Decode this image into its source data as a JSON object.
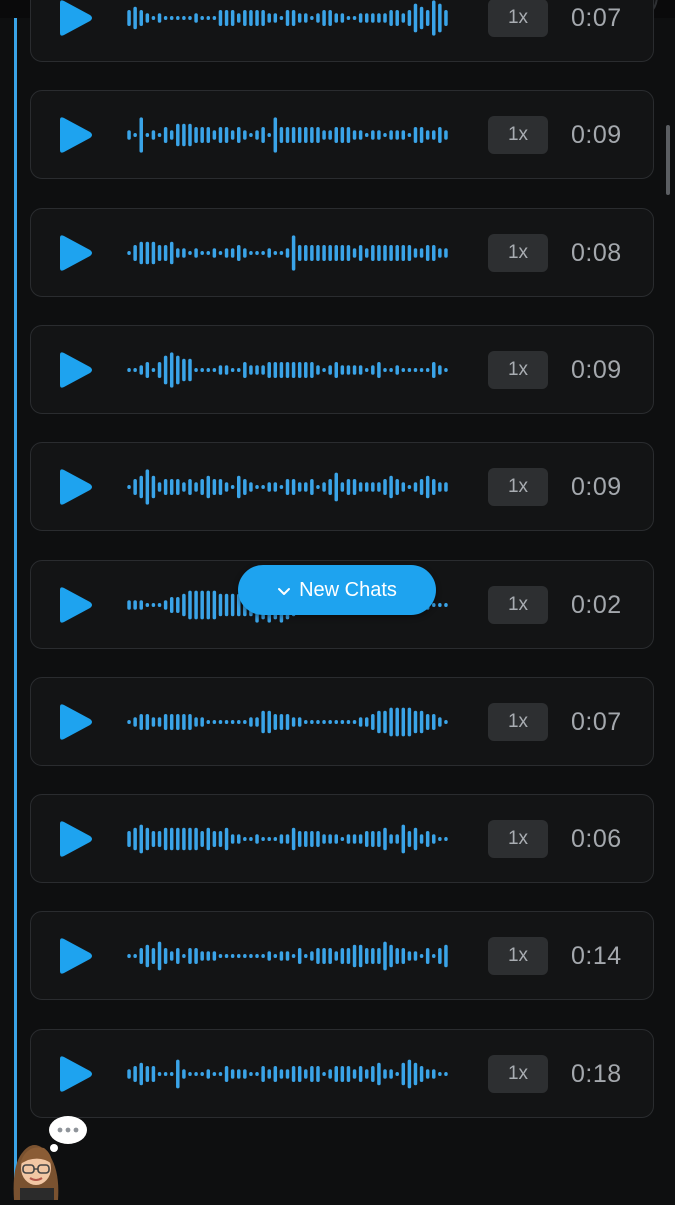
{
  "theme": {
    "accent": "#1ea3ef",
    "wave_color": "#3aa4e8",
    "card_bg": "#131415",
    "background": "#0e0f10"
  },
  "new_chats_button": {
    "label": "New Chats",
    "icon": "chevron-down-icon"
  },
  "voice_notes": [
    {
      "speed": "1x",
      "duration": "0:07",
      "waveform": [
        5,
        7,
        5,
        3,
        2,
        3,
        2,
        2,
        2,
        2,
        2,
        3,
        2,
        2,
        2,
        5,
        5,
        5,
        3,
        5,
        5,
        5,
        5,
        3,
        3,
        2,
        5,
        5,
        3,
        3,
        2,
        3,
        5,
        5,
        3,
        3,
        2,
        2,
        3,
        3,
        3,
        3,
        3,
        5,
        5,
        3,
        5,
        9,
        7,
        5,
        11,
        9,
        5
      ]
    },
    {
      "speed": "1x",
      "duration": "0:09",
      "waveform": [
        3,
        2,
        11,
        2,
        3,
        2,
        5,
        3,
        7,
        7,
        7,
        5,
        5,
        5,
        3,
        5,
        5,
        3,
        5,
        3,
        2,
        3,
        5,
        2,
        11,
        5,
        5,
        5,
        5,
        5,
        5,
        5,
        3,
        3,
        5,
        5,
        5,
        3,
        3,
        2,
        3,
        3,
        2,
        3,
        3,
        3,
        2,
        5,
        5,
        3,
        3,
        5,
        3
      ]
    },
    {
      "speed": "1x",
      "duration": "0:08",
      "waveform": [
        2,
        5,
        7,
        7,
        7,
        5,
        5,
        7,
        3,
        3,
        2,
        3,
        2,
        2,
        3,
        2,
        3,
        3,
        5,
        3,
        2,
        2,
        2,
        3,
        2,
        2,
        3,
        11,
        5,
        5,
        5,
        5,
        5,
        5,
        5,
        5,
        5,
        3,
        5,
        3,
        5,
        5,
        5,
        5,
        5,
        5,
        5,
        3,
        3,
        5,
        5,
        3,
        3
      ]
    },
    {
      "speed": "1x",
      "duration": "0:09",
      "waveform": [
        2,
        2,
        3,
        5,
        2,
        5,
        9,
        11,
        9,
        7,
        7,
        2,
        2,
        2,
        2,
        3,
        3,
        2,
        2,
        5,
        3,
        3,
        3,
        5,
        5,
        5,
        5,
        5,
        5,
        5,
        5,
        3,
        2,
        3,
        5,
        3,
        3,
        3,
        3,
        2,
        3,
        5,
        2,
        2,
        3,
        2,
        2,
        2,
        2,
        2,
        5,
        3,
        2
      ]
    },
    {
      "speed": "1x",
      "duration": "0:09",
      "waveform": [
        2,
        5,
        7,
        11,
        7,
        3,
        5,
        5,
        5,
        3,
        5,
        3,
        5,
        7,
        5,
        5,
        3,
        2,
        7,
        5,
        3,
        2,
        2,
        3,
        3,
        2,
        5,
        5,
        3,
        3,
        5,
        2,
        3,
        5,
        9,
        3,
        5,
        5,
        3,
        3,
        3,
        3,
        5,
        7,
        5,
        3,
        2,
        3,
        5,
        7,
        5,
        3,
        3
      ]
    },
    {
      "speed": "1x",
      "duration": "0:02",
      "waveform": [
        3,
        3,
        3,
        2,
        2,
        2,
        3,
        5,
        5,
        7,
        9,
        9,
        9,
        9,
        9,
        7,
        7,
        7,
        7,
        7,
        7,
        11,
        9,
        11,
        9,
        11,
        9,
        7,
        5,
        5,
        5,
        5,
        5,
        5,
        5,
        5,
        5,
        3,
        3,
        3,
        3,
        3,
        3,
        3,
        3,
        3,
        3,
        3,
        3,
        3,
        2,
        2,
        2
      ]
    },
    {
      "speed": "1x",
      "duration": "0:07",
      "waveform": [
        2,
        3,
        5,
        5,
        3,
        3,
        5,
        5,
        5,
        5,
        5,
        3,
        3,
        2,
        2,
        2,
        2,
        2,
        2,
        2,
        3,
        3,
        7,
        7,
        5,
        5,
        5,
        3,
        3,
        2,
        2,
        2,
        2,
        2,
        2,
        2,
        2,
        2,
        3,
        3,
        5,
        7,
        7,
        9,
        9,
        9,
        9,
        7,
        7,
        5,
        5,
        3,
        2
      ]
    },
    {
      "speed": "1x",
      "duration": "0:06",
      "waveform": [
        5,
        7,
        9,
        7,
        5,
        5,
        7,
        7,
        7,
        7,
        7,
        7,
        5,
        7,
        5,
        5,
        7,
        3,
        3,
        2,
        2,
        3,
        2,
        2,
        2,
        3,
        3,
        7,
        5,
        5,
        5,
        5,
        3,
        3,
        3,
        2,
        3,
        3,
        3,
        5,
        5,
        5,
        7,
        3,
        3,
        9,
        5,
        7,
        3,
        5,
        3,
        2,
        2
      ]
    },
    {
      "speed": "1x",
      "duration": "0:14",
      "waveform": [
        2,
        2,
        5,
        7,
        5,
        9,
        5,
        3,
        5,
        2,
        5,
        5,
        3,
        3,
        3,
        2,
        2,
        2,
        2,
        2,
        2,
        2,
        2,
        3,
        2,
        3,
        3,
        2,
        5,
        2,
        3,
        5,
        5,
        5,
        3,
        5,
        5,
        7,
        7,
        5,
        5,
        5,
        9,
        7,
        5,
        5,
        3,
        3,
        2,
        5,
        2,
        5,
        7
      ]
    },
    {
      "speed": "1x",
      "duration": "0:18",
      "waveform": [
        3,
        5,
        7,
        5,
        5,
        2,
        2,
        2,
        9,
        3,
        2,
        2,
        2,
        3,
        2,
        2,
        5,
        3,
        3,
        3,
        2,
        2,
        5,
        3,
        5,
        3,
        3,
        5,
        5,
        3,
        5,
        5,
        2,
        3,
        5,
        5,
        5,
        3,
        5,
        3,
        5,
        7,
        3,
        3,
        2,
        7,
        9,
        7,
        5,
        3,
        3,
        2,
        2
      ]
    }
  ]
}
